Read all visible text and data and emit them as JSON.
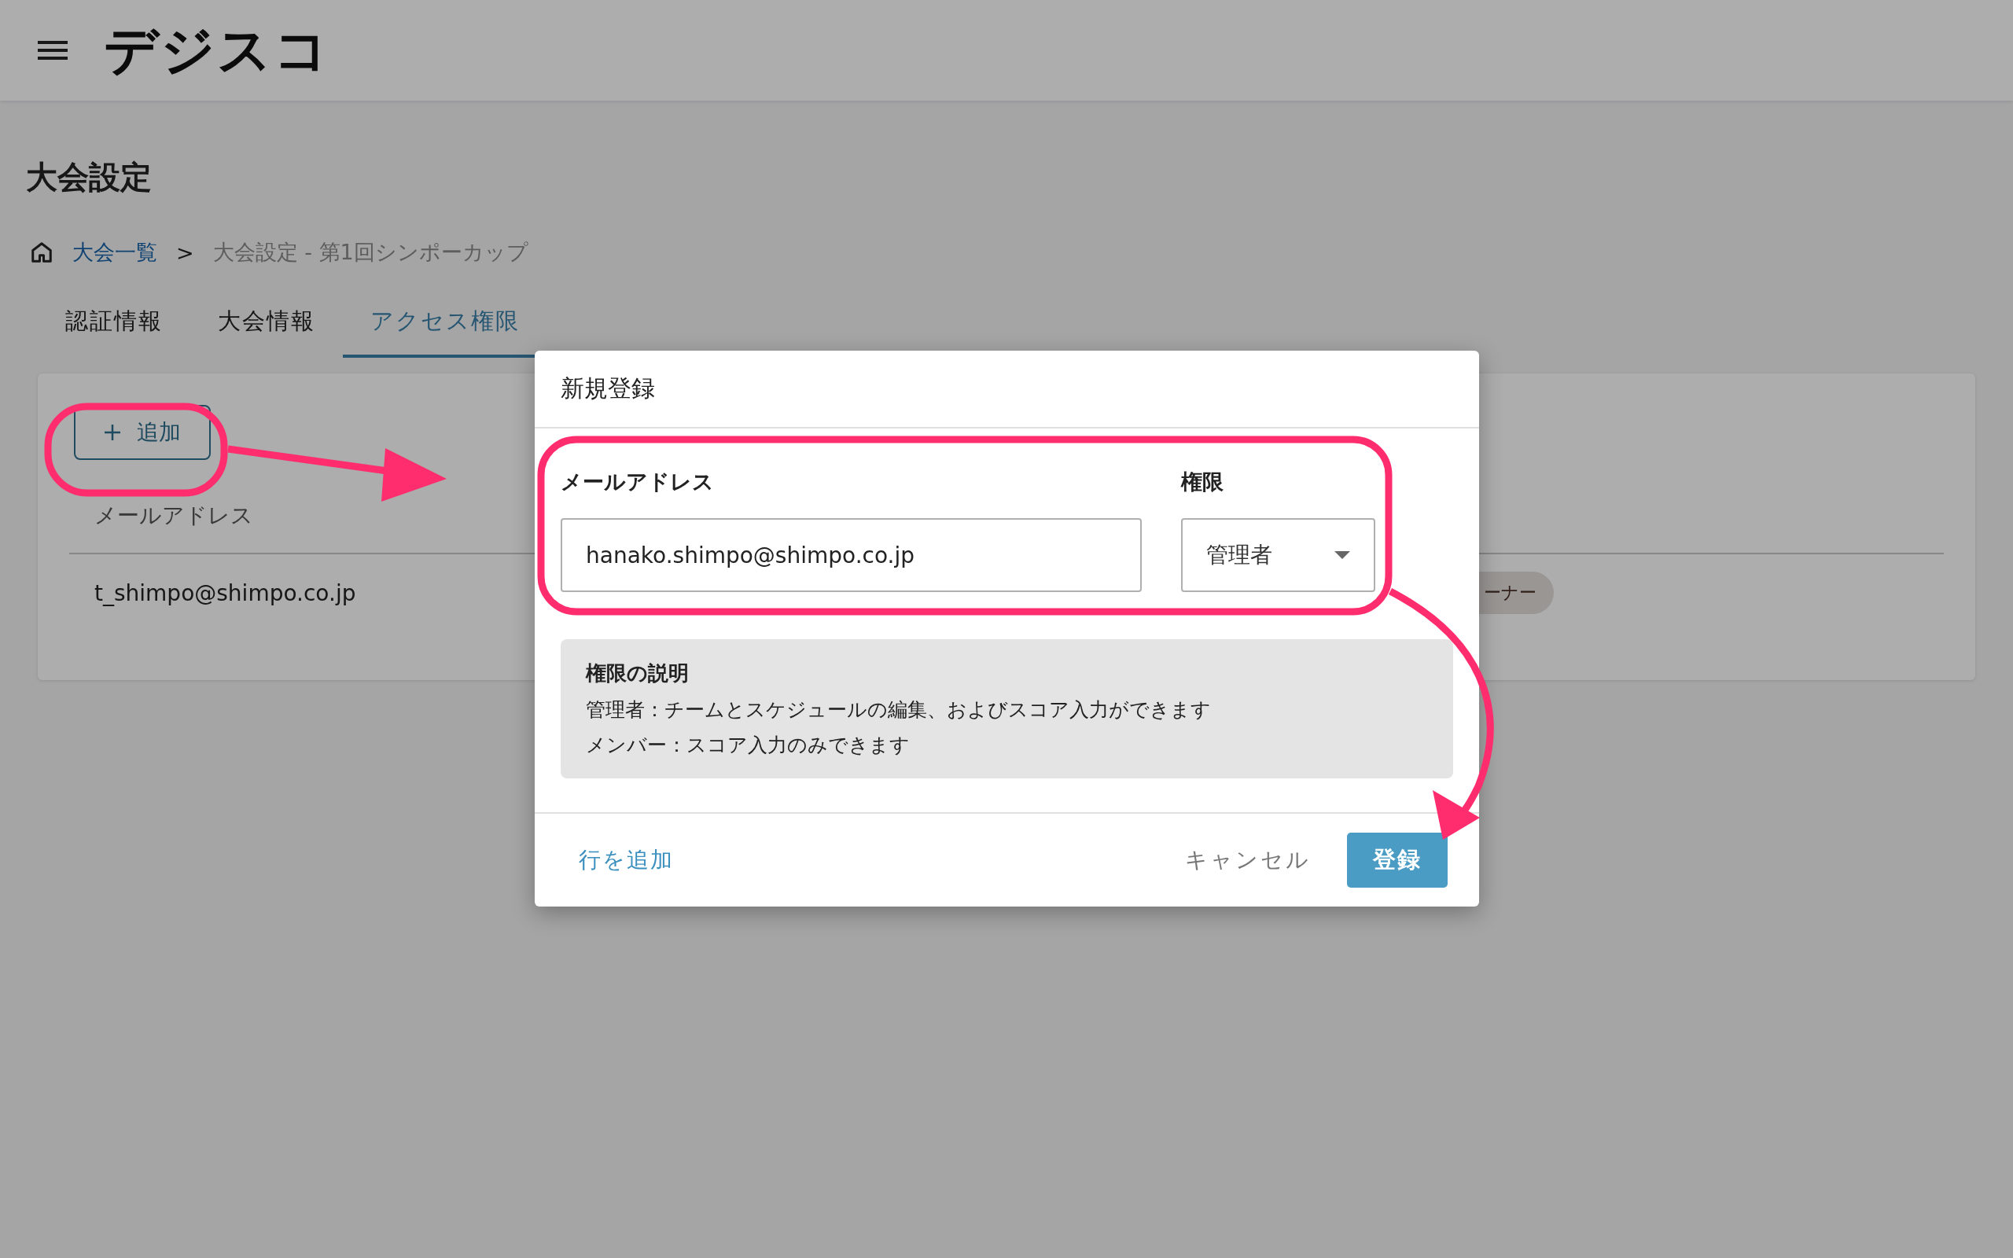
{
  "header": {
    "logo": "デジスコ"
  },
  "page": {
    "title": "大会設定"
  },
  "breadcrumb": [
    {
      "label": "大会一覧",
      "kind": "link"
    },
    {
      "label": ">",
      "kind": "separator"
    },
    {
      "label": "大会設定 - 第1回シンポーカップ",
      "kind": "current"
    }
  ],
  "tabs": [
    {
      "label": "認証情報",
      "selected": false
    },
    {
      "label": "大会情報",
      "selected": false
    },
    {
      "label": "アクセス権限",
      "selected": true
    }
  ],
  "card": {
    "add_button": "追加",
    "columns": [
      "メールアドレス"
    ],
    "rows": [
      {
        "email": "t_shimpo@shimpo.co.jp",
        "role_chip": "ーナー"
      }
    ]
  },
  "dialog": {
    "title": "新規登録",
    "email_label": "メールアドレス",
    "email_value": "hanako.shimpo@shimpo.co.jp",
    "role_label": "権限",
    "role_value": "管理者",
    "description": {
      "title": "権限の説明",
      "lines": [
        "管理者：チームとスケジュールの編集、およびスコア入力ができます",
        "メンバー：スコア入力のみできます"
      ]
    },
    "add_row_link": "行を追加",
    "cancel_button": "キャンセル",
    "submit_button": "登録"
  }
}
